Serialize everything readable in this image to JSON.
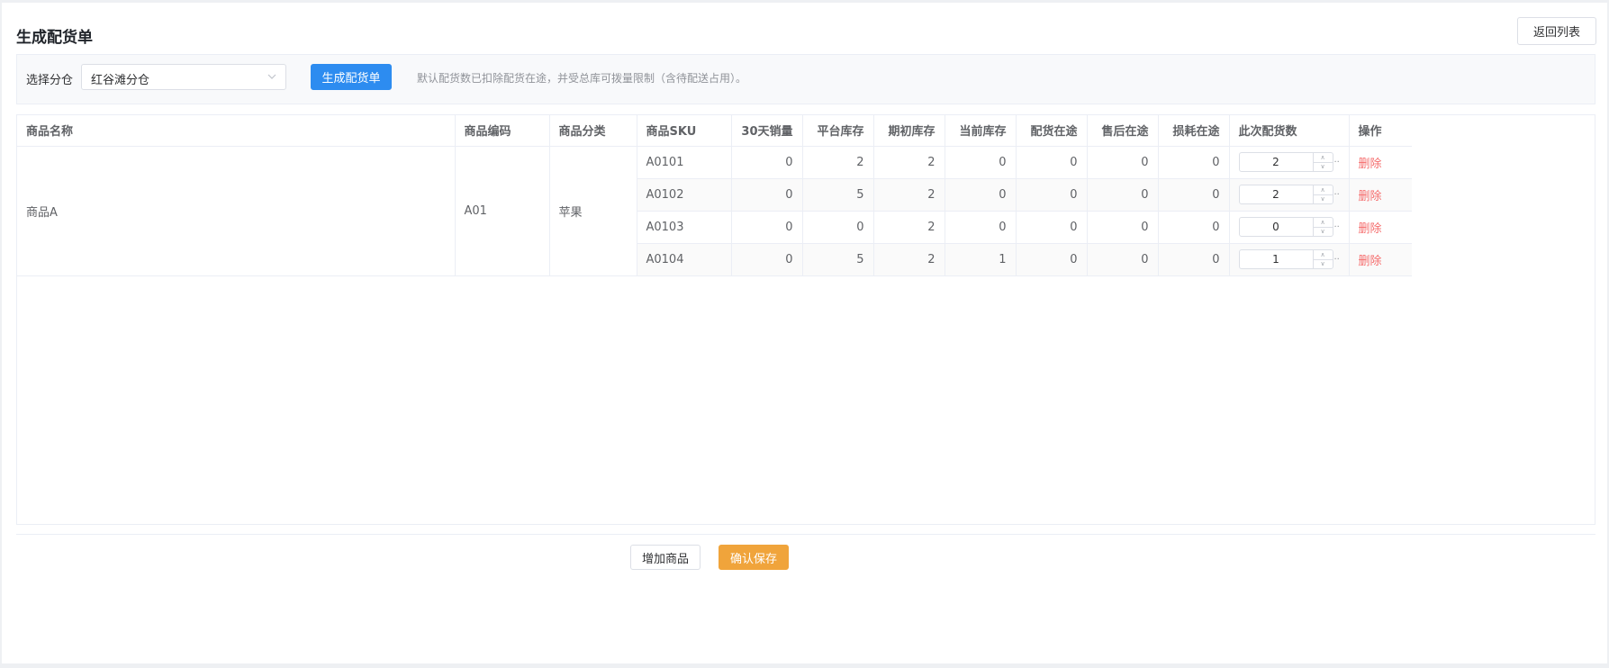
{
  "page": {
    "title": "生成配货单",
    "back_label": "返回列表"
  },
  "filter": {
    "label": "选择分仓",
    "selected": "红谷滩分仓",
    "generate_label": "生成配货单",
    "hint": "默认配货数已扣除配货在途，并受总库可拨量限制（含待配送占用）。"
  },
  "table": {
    "headers": [
      "商品名称",
      "商品编码",
      "商品分类",
      "商品SKU",
      "30天销量",
      "平台库存",
      "期初库存",
      "当前库存",
      "配货在途",
      "售后在途",
      "损耗在途",
      "此次配货数",
      "操作"
    ],
    "product": {
      "name": "商品A",
      "code": "A01",
      "category": "苹果"
    },
    "rows": [
      {
        "sku": "A0101",
        "sales_30d": "0",
        "platform_stock": "2",
        "initial_stock": "2",
        "current_stock": "0",
        "transit": "0",
        "aftersale": "0",
        "loss": "0",
        "qty": "2"
      },
      {
        "sku": "A0102",
        "sales_30d": "0",
        "platform_stock": "5",
        "initial_stock": "2",
        "current_stock": "0",
        "transit": "0",
        "aftersale": "0",
        "loss": "0",
        "qty": "2"
      },
      {
        "sku": "A0103",
        "sales_30d": "0",
        "platform_stock": "0",
        "initial_stock": "2",
        "current_stock": "0",
        "transit": "0",
        "aftersale": "0",
        "loss": "0",
        "qty": "0"
      },
      {
        "sku": "A0104",
        "sales_30d": "0",
        "platform_stock": "5",
        "initial_stock": "2",
        "current_stock": "1",
        "transit": "0",
        "aftersale": "0",
        "loss": "0",
        "qty": "1"
      }
    ],
    "delete_label": "删除"
  },
  "footer": {
    "add_label": "增加商品",
    "save_label": "确认保存"
  },
  "colors": {
    "primary": "#2d8cf0",
    "warning": "#f0a43b",
    "danger": "#f56c6c"
  },
  "icons": {
    "select_arrow": "chevron-down-icon",
    "stepper_up": "chevron-up-icon",
    "stepper_down": "chevron-down-icon"
  }
}
